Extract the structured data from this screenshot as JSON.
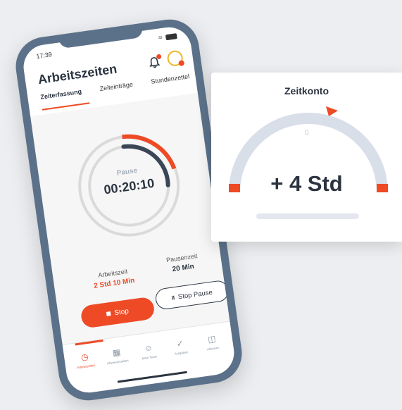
{
  "status_bar": {
    "time": "17:39"
  },
  "header": {
    "title": "Arbeitszeiten",
    "tabs": [
      {
        "label": "Zeiterfassung",
        "active": true
      },
      {
        "label": "Zeiteinträge",
        "active": false
      },
      {
        "label": "Stundenzettel",
        "active": false
      }
    ]
  },
  "timer": {
    "label": "Pause",
    "value": "00:20:10"
  },
  "stats": {
    "work": {
      "label": "Arbeitszeit",
      "value": "2 Std 10 Min"
    },
    "pause": {
      "label": "Pausenzeit",
      "value": "20 Min"
    }
  },
  "buttons": {
    "stop": "Stop",
    "stop_pause": "Stop Pause"
  },
  "bottom_nav": [
    {
      "label": "Arbeitszeiten",
      "icon": "clock-icon",
      "active": true
    },
    {
      "label": "Abwesenheiten",
      "icon": "calendar-icon",
      "active": false
    },
    {
      "label": "Mein Team",
      "icon": "team-icon",
      "active": false
    },
    {
      "label": "Aufgaben",
      "icon": "check-icon",
      "active": false
    },
    {
      "label": "Aktionen",
      "icon": "grid-icon",
      "active": false
    }
  ],
  "zeitkonto": {
    "title": "Zeitkonto",
    "zero_label": "0",
    "value": "+ 4 Std"
  },
  "colors": {
    "accent": "#ee4a25",
    "dark": "#2b3440",
    "frame": "#5b7189"
  }
}
